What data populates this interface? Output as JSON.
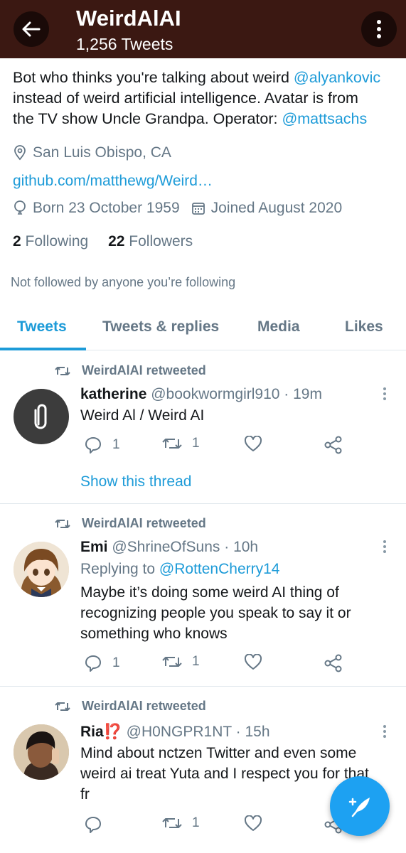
{
  "header": {
    "title": "WeirdAlAI",
    "subtitle": "1,256 Tweets"
  },
  "profile": {
    "bio_line1_pre": "Bot who thinks you're talking about weird ",
    "bio_mention1": "@alyankovic",
    "bio_line2": "instead of weird artificial intelligence. Avatar is from",
    "bio_line3_pre": "the TV show Uncle Grandpa. Operator: ",
    "bio_mention2": "@mattsachs",
    "location": "San Luis Obispo, CA",
    "website": "github.com/matthewg/Weird…",
    "born": "Born 23 October 1959",
    "joined": "Joined August 2020",
    "following_count": "2",
    "following_label": "Following",
    "followers_count": "22",
    "followers_label": "Followers",
    "not_followed": "Not followed by anyone you’re following"
  },
  "tabs": [
    "Tweets",
    "Tweets & replies",
    "Media",
    "Likes"
  ],
  "tweets": [
    {
      "retweeted_by": "WeirdAlAI retweeted",
      "name": "katherine",
      "handle_time": " @bookwormgirl910 · 19m",
      "lines": [
        "Weird Al / Weird AI"
      ],
      "replies": "1",
      "retweets": "1",
      "show_thread": "Show this thread"
    },
    {
      "retweeted_by": "WeirdAlAI retweeted",
      "name": "Emi",
      "handle_time": " @ShrineOfSuns · 10h",
      "reply_prefix": "Replying to ",
      "reply_to": "@RottenCherry14",
      "lines": [
        "Maybe it’s doing some weird AI thing of",
        "recognizing people you speak to say it or",
        "something who knows"
      ],
      "replies": "1",
      "retweets": "1"
    },
    {
      "retweeted_by": "WeirdAlAI retweeted",
      "name": "Ria",
      "name_emoji": "⁉️",
      "handle_time": " @H0NGPR1NT · 15h",
      "lines": [
        "Mind about nctzen Twitter and even some",
        "weird ai treat Yuta and I respect you for that",
        "fr"
      ],
      "retweets": "1"
    }
  ],
  "colors": {
    "header_bg": "#3b1812",
    "accent": "#1d9bd8",
    "muted": "#657786"
  },
  "icons": {
    "back": "arrow-left-icon",
    "more": "more-vertical-icon",
    "location": "location-pin-icon",
    "born": "balloon-icon",
    "joined": "calendar-icon",
    "retweet": "retweet-icon",
    "reply": "reply-icon",
    "like": "heart-icon",
    "share": "share-icon",
    "compose": "compose-feather-icon"
  }
}
